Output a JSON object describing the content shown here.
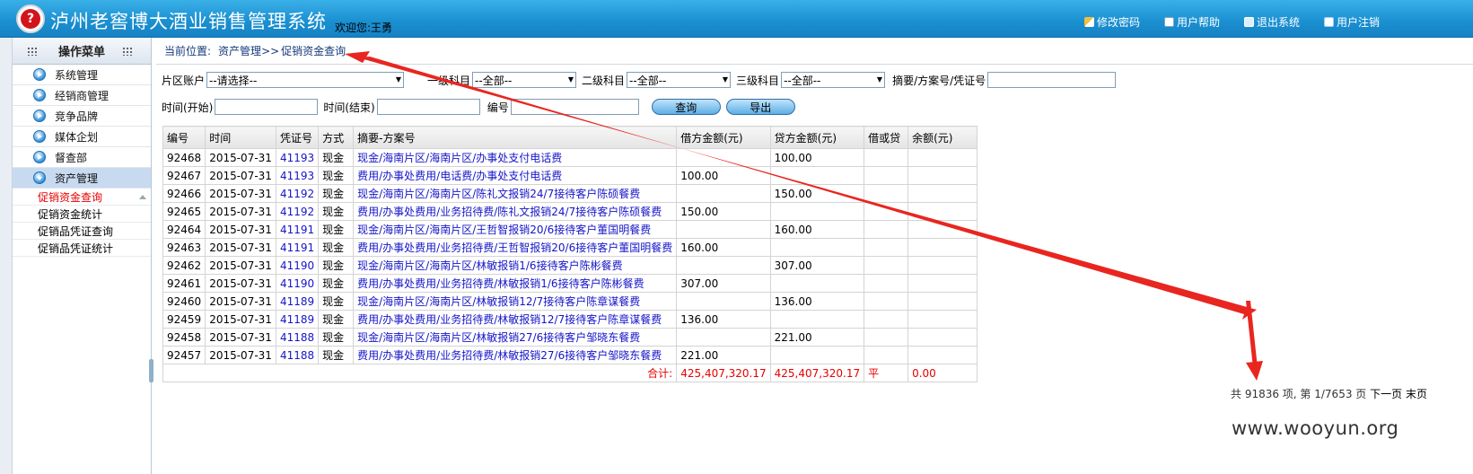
{
  "header": {
    "app_title": "泸州老窖博大酒业销售管理系统",
    "logo_glyph": "?",
    "welcome": "欢迎您:王勇",
    "links": [
      {
        "label": "修改密码",
        "icon": "key-icon"
      },
      {
        "label": "用户帮助",
        "icon": "help-icon"
      },
      {
        "label": "退出系统",
        "icon": "exit-icon"
      },
      {
        "label": "用户注销",
        "icon": "logout-icon"
      }
    ]
  },
  "sidebar": {
    "title": "操作菜单",
    "items": [
      {
        "label": "系统管理"
      },
      {
        "label": "经销商管理"
      },
      {
        "label": "竞争品牌"
      },
      {
        "label": "媒体企划"
      },
      {
        "label": "督查部"
      },
      {
        "label": "资产管理"
      }
    ],
    "sub_items": [
      {
        "label": "促销资金查询"
      },
      {
        "label": "促销资金统计"
      },
      {
        "label": "促销品凭证查询"
      },
      {
        "label": "促销品凭证统计"
      }
    ]
  },
  "breadcrumb": {
    "prefix": "当前位置:",
    "section": "资产管理",
    "sep": ">>",
    "page": "促销资金查询"
  },
  "filters": {
    "area_label": "片区账户",
    "area_value": "--请选择--",
    "l1_label": "一级科目",
    "l1_value": "--全部--",
    "l2_label": "二级科目",
    "l2_value": "--全部--",
    "l3_label": "三级科目",
    "l3_value": "--全部--",
    "summary_label": "摘要/方案号/凭证号",
    "summary_value": "",
    "time_start_label": "时间(开始)",
    "time_start_value": "",
    "time_end_label": "时间(结束)",
    "time_end_value": "",
    "number_label": "编号",
    "number_value": "",
    "query_button": "查询",
    "export_button": "导出"
  },
  "table": {
    "headers": [
      "编号",
      "时间",
      "凭证号",
      "方式",
      "摘要-方案号",
      "借方金额(元)",
      "贷方金额(元)",
      "借或贷",
      "余额(元)"
    ],
    "rows": [
      {
        "id": "92468",
        "date": "2015-07-31",
        "voucher": "41193",
        "method": "现金",
        "summary": "现金/海南片区/海南片区/办事处支付电话费",
        "debit": "",
        "credit": "100.00",
        "dc": "",
        "balance": ""
      },
      {
        "id": "92467",
        "date": "2015-07-31",
        "voucher": "41193",
        "method": "现金",
        "summary": "费用/办事处费用/电话费/办事处支付电话费",
        "debit": "100.00",
        "credit": "",
        "dc": "",
        "balance": ""
      },
      {
        "id": "92466",
        "date": "2015-07-31",
        "voucher": "41192",
        "method": "现金",
        "summary": "现金/海南片区/海南片区/陈礼文报销24/7接待客户陈硕餐费",
        "debit": "",
        "credit": "150.00",
        "dc": "",
        "balance": ""
      },
      {
        "id": "92465",
        "date": "2015-07-31",
        "voucher": "41192",
        "method": "现金",
        "summary": "费用/办事处费用/业务招待费/陈礼文报销24/7接待客户陈硕餐费",
        "debit": "150.00",
        "credit": "",
        "dc": "",
        "balance": ""
      },
      {
        "id": "92464",
        "date": "2015-07-31",
        "voucher": "41191",
        "method": "现金",
        "summary": "现金/海南片区/海南片区/王哲智报销20/6接待客户董国明餐费",
        "debit": "",
        "credit": "160.00",
        "dc": "",
        "balance": ""
      },
      {
        "id": "92463",
        "date": "2015-07-31",
        "voucher": "41191",
        "method": "现金",
        "summary": "费用/办事处费用/业务招待费/王哲智报销20/6接待客户董国明餐费",
        "debit": "160.00",
        "credit": "",
        "dc": "",
        "balance": ""
      },
      {
        "id": "92462",
        "date": "2015-07-31",
        "voucher": "41190",
        "method": "现金",
        "summary": "现金/海南片区/海南片区/林敏报销1/6接待客户陈彬餐费",
        "debit": "",
        "credit": "307.00",
        "dc": "",
        "balance": ""
      },
      {
        "id": "92461",
        "date": "2015-07-31",
        "voucher": "41190",
        "method": "现金",
        "summary": "费用/办事处费用/业务招待费/林敏报销1/6接待客户陈彬餐费",
        "debit": "307.00",
        "credit": "",
        "dc": "",
        "balance": ""
      },
      {
        "id": "92460",
        "date": "2015-07-31",
        "voucher": "41189",
        "method": "现金",
        "summary": "现金/海南片区/海南片区/林敏报销12/7接待客户陈章谋餐费",
        "debit": "",
        "credit": "136.00",
        "dc": "",
        "balance": ""
      },
      {
        "id": "92459",
        "date": "2015-07-31",
        "voucher": "41189",
        "method": "现金",
        "summary": "费用/办事处费用/业务招待费/林敏报销12/7接待客户陈章谋餐费",
        "debit": "136.00",
        "credit": "",
        "dc": "",
        "balance": ""
      },
      {
        "id": "92458",
        "date": "2015-07-31",
        "voucher": "41188",
        "method": "现金",
        "summary": "现金/海南片区/海南片区/林敏报销27/6接待客户邹晓东餐费",
        "debit": "",
        "credit": "221.00",
        "dc": "",
        "balance": ""
      },
      {
        "id": "92457",
        "date": "2015-07-31",
        "voucher": "41188",
        "method": "现金",
        "summary": "费用/办事处费用/业务招待费/林敏报销27/6接待客户邹晓东餐费",
        "debit": "221.00",
        "credit": "",
        "dc": "",
        "balance": ""
      }
    ],
    "total": {
      "label": "合计:",
      "debit": "425,407,320.17",
      "credit": "425,407,320.17",
      "dc": "平",
      "balance": "0.00"
    }
  },
  "pager": {
    "summary": "共 91836 项, 第 1/7653 页",
    "next": "下一页",
    "last": "末页"
  },
  "watermark": "www.wooyun.org",
  "colors": {
    "header_blue": "#1a8fd0",
    "link_blue": "#1515c8",
    "alert_red": "#e60000",
    "annotation_arrow": "#e8261f"
  }
}
